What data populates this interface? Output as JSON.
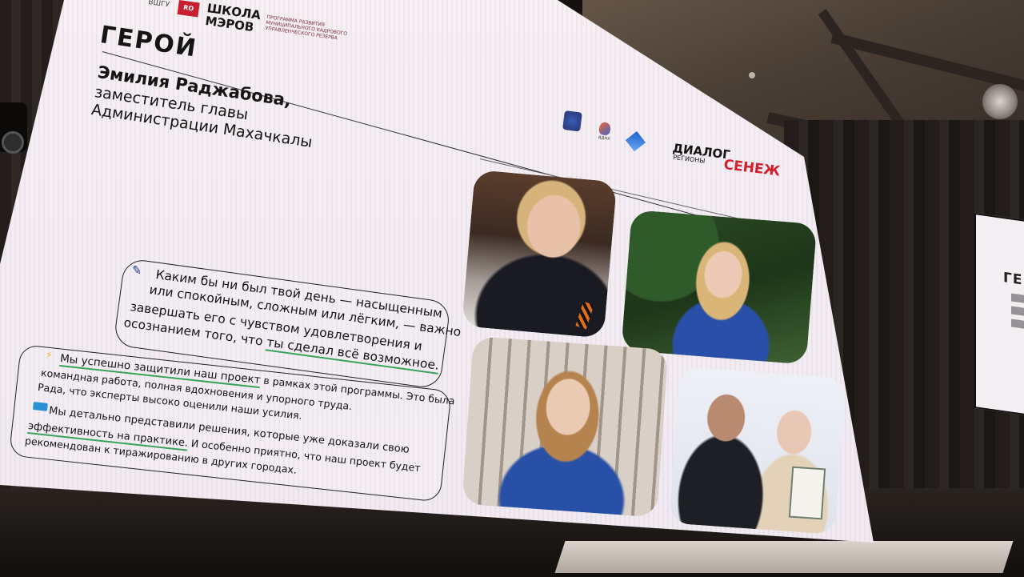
{
  "slide": {
    "section_title": "ГЕРОЙ",
    "hero_name": "Эмилия Раджабова,",
    "hero_position_line1": "заместитель главы",
    "hero_position_line2": "Администрации Махачкалы"
  },
  "logos": {
    "vshu": "ВШГУ",
    "mark": "RO",
    "school_line1": "ШКОЛА",
    "school_line2": "МЭРОВ",
    "school_subtitle": "ПРОГРАММА РАЗВИТИЯ МУНИЦИПАЛЬНОГО КАДРОВОГО УПРАВЛЕНЧЕСКОГО РЕЗЕРВА",
    "partner_flame": "ВДНХ",
    "partner_dialog": "ДИАЛОГ",
    "partner_dialog_sub": "РЕГИОНЫ",
    "partner_senezh": "СЕНЕЖ"
  },
  "quote": {
    "line1": "Каким бы ни был твой день — насыщенным",
    "line2": "или спокойным, сложным или лёгким, — важно",
    "line3": "завершать его с чувством удовлетворения и",
    "line4_prefix": "осознанием того, что ",
    "line4_highlight": "ты сделал всё возможное."
  },
  "story": {
    "line1_highlight": "Мы успешно защитили наш проект",
    "line1_rest": " в рамках этой программы. Это была",
    "line2": "командная работа, полная вдохновения и упорного труда.",
    "line3": "Рада, что эксперты высоко оценили наши усилия.",
    "line4": "Мы детально представили решения, которые уже доказали свою",
    "line5_highlight": "эффективность на практике.",
    "line5_rest": " И особенно приятно, что наш проект будет",
    "line6": "рекомендован к тиражированию в других городах."
  },
  "second_screen": {
    "title": "ГЕР"
  },
  "colors": {
    "slide_bg": "#f4edf3",
    "underline_green": "#3aa35a",
    "senezh_red": "#d1202f",
    "text": "#141414"
  }
}
